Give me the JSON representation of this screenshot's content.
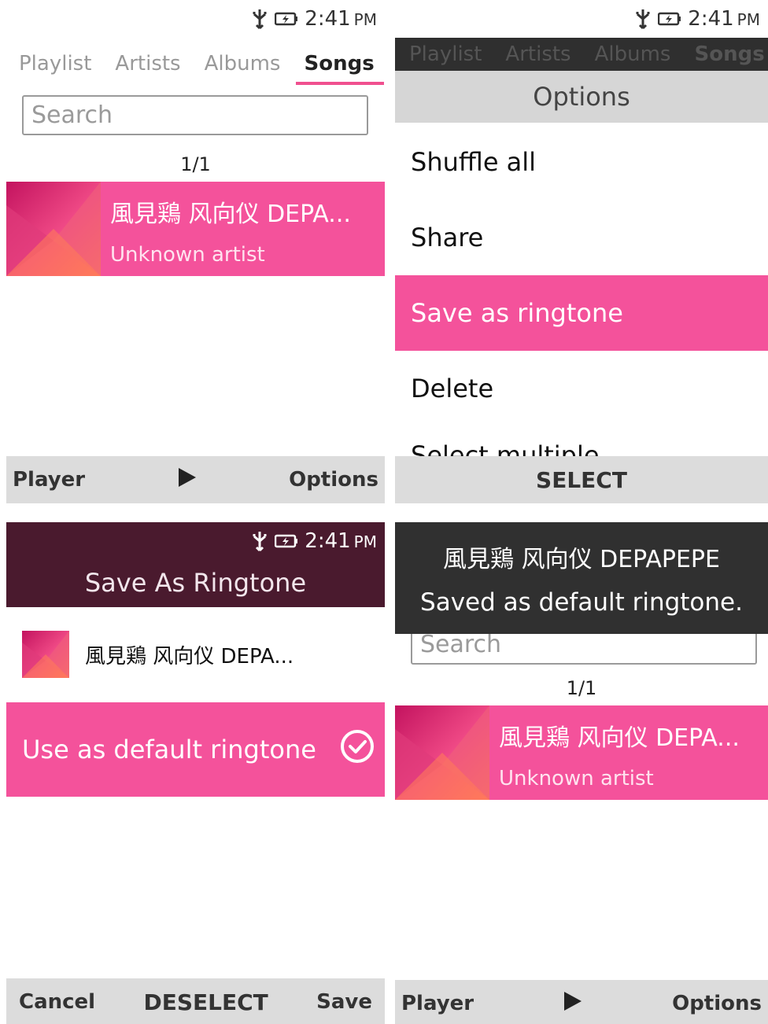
{
  "status": {
    "time": "2:41",
    "ampm": "PM"
  },
  "tabs": [
    "Playlist",
    "Artists",
    "Albums",
    "Songs"
  ],
  "search": {
    "placeholder": "Search"
  },
  "song": {
    "count": "1/1",
    "title": "風見鶏 风向仪 DEPA...",
    "artist": "Unknown artist"
  },
  "softkeys_main": {
    "left": "Player",
    "right": "Options"
  },
  "options_menu": {
    "header": "Options",
    "items": [
      "Shuffle all",
      "Share",
      "Save as ringtone",
      "Delete"
    ],
    "cut_item": "Select multiple",
    "softkey_center": "SELECT"
  },
  "save_ringtone": {
    "title": "Save As Ringtone",
    "song_title": "風見鶏 风向仪 DEPA...",
    "default_label": "Use as default ringtone",
    "softkeys": {
      "left": "Cancel",
      "center": "DESELECT",
      "right": "Save"
    }
  },
  "toast": {
    "line1": "風見鶏 风向仪 DEPAPEPE",
    "line2": "Saved as default ringtone."
  },
  "colors": {
    "accent": "#f4529b",
    "header_dark": "#4a1a2e",
    "softkey_bg": "#dcdcdc"
  }
}
